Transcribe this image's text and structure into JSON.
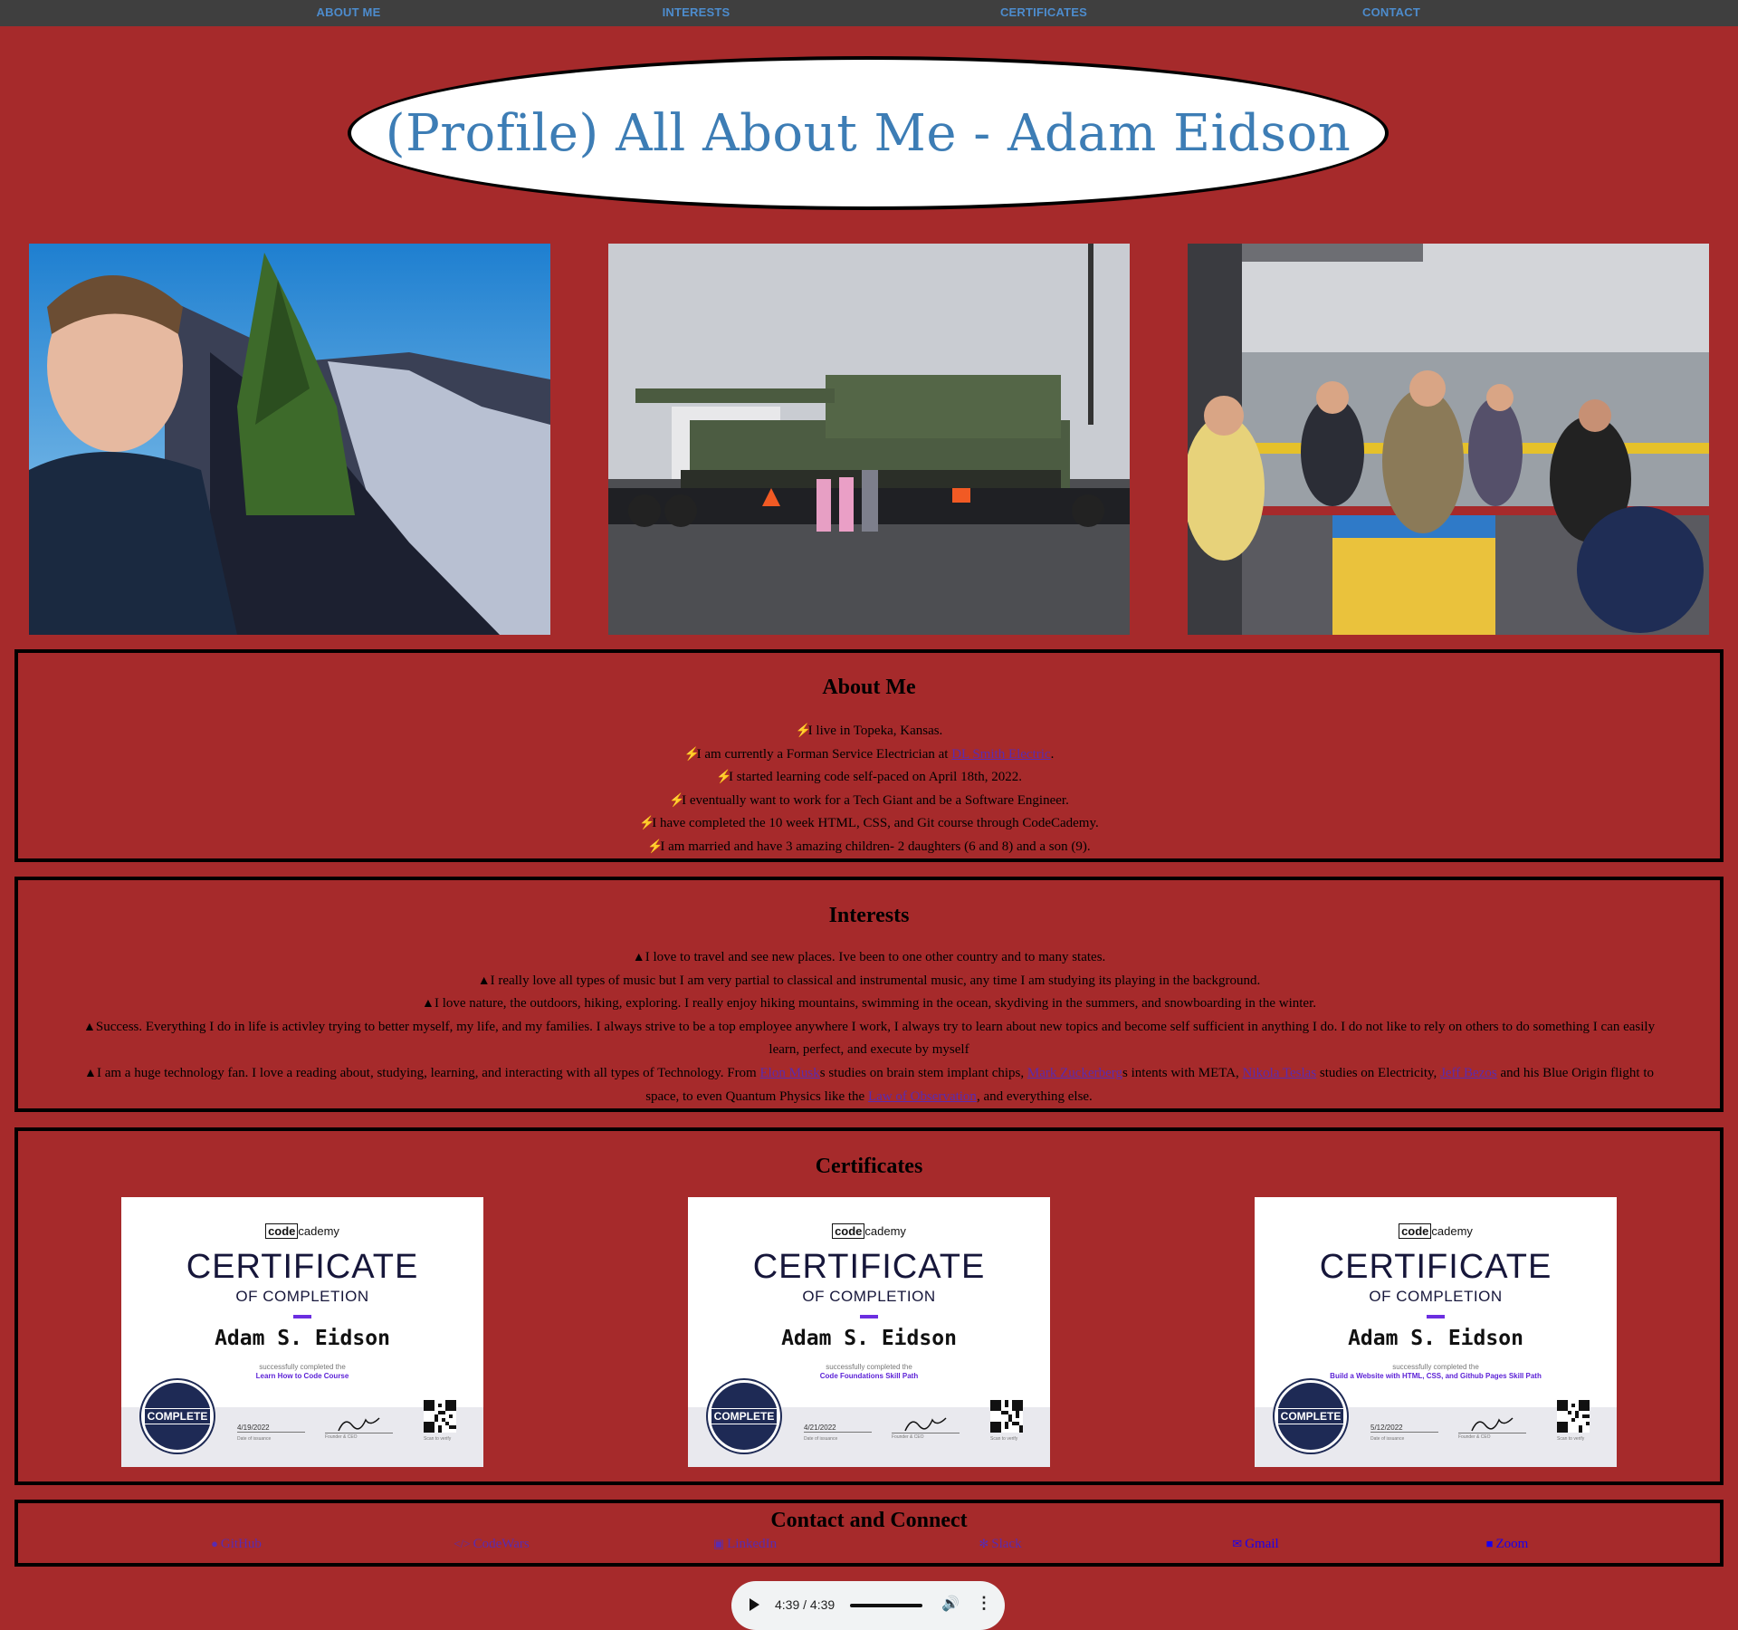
{
  "nav": {
    "items": [
      "ABOUT ME",
      "INTERESTS",
      "CERTIFICATES",
      "CONTACT"
    ]
  },
  "header": {
    "title": "(Profile) All About Me - Adam Eidson"
  },
  "photos": [
    {
      "subject": "selfie-mountain"
    },
    {
      "subject": "kids-tank"
    },
    {
      "subject": "fishing-boat"
    }
  ],
  "about": {
    "heading": "About Me",
    "icon": "bolt-icon",
    "lines": [
      {
        "text": "I live in Topeka, Kansas."
      },
      {
        "before": "I am currently a Forman Service Electrician at ",
        "link": "DL Smith Electric",
        "after": "."
      },
      {
        "text": "I started learning code self-paced on April 18th, 2022."
      },
      {
        "text": "I eventually want to work for a Tech Giant and be a Software Engineer."
      },
      {
        "text": "I have completed the 10 week HTML, CSS, and Git course through CodeCademy."
      },
      {
        "text": "I am married and have 3 amazing children- 2 daughters (6 and 8) and a son (9)."
      }
    ]
  },
  "interests": {
    "heading": "Interests",
    "icon": "tree-icon",
    "line1": "I love to travel and see new places. Ive been to one other country and to many states.",
    "line2": "I really love all types of music but I am very partial to classical and instrumental music, any time I am studying its playing in the background.",
    "line3": "I love nature, the outdoors, hiking, exploring. I really enjoy hiking mountains, swimming in the ocean, skydiving in the summers, and snowboarding in the winter.",
    "line4a": "Success. Everything I do in life is activley trying to better myself, my life, and my families. I always strive to be a top employee anywhere I work, I always try to learn about new topics and become self sufficient in anything I do. I do not like to rely on others to do something I can easily",
    "line4b": "learn, perfect, and execute by myself",
    "line5": {
      "t1": "I am a huge technology fan. I love a reading about, studying, learning, and interacting with all types of Technology. From ",
      "l1": "Elon Musk",
      "t2": "s studies on brain stem implant chips, ",
      "l2": "Mark Zuckerberg",
      "t3": "s intents with META, ",
      "l3": "Nikola Teslas",
      "t4": " studies on Electricity, ",
      "l4": "Jeff Bezos",
      "t5": " and his Blue Origin flight to",
      "t6": "space, to even Quantum Physics like the ",
      "l5": "Law of Observation",
      "t7": ", and everything else."
    }
  },
  "certificates": {
    "heading": "Certificates",
    "items": [
      {
        "brand_box": "code",
        "brand_rest": "cademy",
        "title": "CERTIFICATE",
        "subtitle": "OF COMPLETION",
        "name": "Adam S. Eidson",
        "completed": "successfully completed the",
        "course": "Learn How to Code Course",
        "seal": "COMPLETE",
        "date": "4/19/2022",
        "date_label": "Date of issuance",
        "sig_label": "Founder & CEO",
        "qr_label": "Scan to verify"
      },
      {
        "brand_box": "code",
        "brand_rest": "cademy",
        "title": "CERTIFICATE",
        "subtitle": "OF COMPLETION",
        "name": "Adam S. Eidson",
        "completed": "successfully completed the",
        "course": "Code Foundations Skill Path",
        "seal": "COMPLETE",
        "date": "4/21/2022",
        "date_label": "Date of issuance",
        "sig_label": "Founder & CEO",
        "qr_label": "Scan to verify"
      },
      {
        "brand_box": "code",
        "brand_rest": "cademy",
        "title": "CERTIFICATE",
        "subtitle": "OF COMPLETION",
        "name": "Adam S. Eidson",
        "completed": "successfully completed the",
        "course": "Build a Website with HTML, CSS, and Github Pages Skill Path",
        "seal": "COMPLETE",
        "date": "5/12/2022",
        "date_label": "Date of issuance",
        "sig_label": "Founder & CEO",
        "qr_label": "Scan to verify"
      }
    ]
  },
  "contact": {
    "heading": "Contact and Connect",
    "links": [
      {
        "label": "GitHub",
        "icon": "github-icon",
        "color": "#5a2bb0"
      },
      {
        "label": "CodeWars",
        "icon": "code-icon",
        "color": "#5a2bb0"
      },
      {
        "label": "LinkedIn",
        "icon": "linkedin-icon",
        "color": "#5a2bb0"
      },
      {
        "label": "Slack",
        "icon": "slack-icon",
        "color": "#5a2bb0"
      },
      {
        "label": "Gmail",
        "icon": "envelope-icon",
        "color": "#1a00ee"
      },
      {
        "label": "Zoom",
        "icon": "video-icon",
        "color": "#1a00ee"
      }
    ]
  },
  "audio": {
    "time": "4:39 / 4:39"
  },
  "colors": {
    "background": "#a62a2b",
    "nav": "#3f3f3f",
    "nav_link": "#4d8ccd",
    "title": "#3d7db5"
  }
}
